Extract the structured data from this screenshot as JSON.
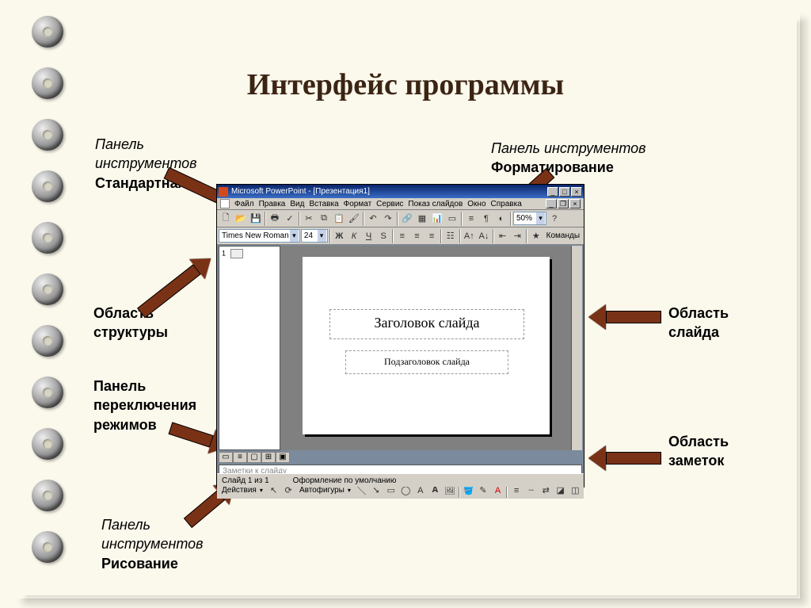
{
  "title": "Интерфейс программы",
  "labels": {
    "standard_toolbar_i": "Панель\nинструментов",
    "standard_toolbar_b": "Стандартная",
    "format_toolbar_i": "Панель инструментов",
    "format_toolbar_b": "Форматирование",
    "outline_area": "Область\nструктуры",
    "view_panel": "Панель\nпереключения\nрежимов",
    "draw_toolbar_i": "Панель\nинструментов",
    "draw_toolbar_b": "Рисование",
    "slide_area": "Область\nслайда",
    "notes_area": "Область\nзаметок"
  },
  "app": {
    "title": "Microsoft PowerPoint - [Презентация1]",
    "menus": [
      "Файл",
      "Правка",
      "Вид",
      "Вставка",
      "Формат",
      "Сервис",
      "Показ слайдов",
      "Окно",
      "Справка"
    ],
    "font_name": "Times New Roman",
    "font_size": "24",
    "zoom": "50%",
    "commands": "Команды",
    "slide_title_ph": "Заголовок слайда",
    "slide_sub_ph": "Подзаголовок слайда",
    "notes_ph": "Заметки к слайду",
    "outline_num": "1",
    "draw_actions": "Действия",
    "draw_autoshapes": "Автофигуры",
    "status_slide": "Слайд 1 из 1",
    "status_template": "Оформление по умолчанию"
  }
}
